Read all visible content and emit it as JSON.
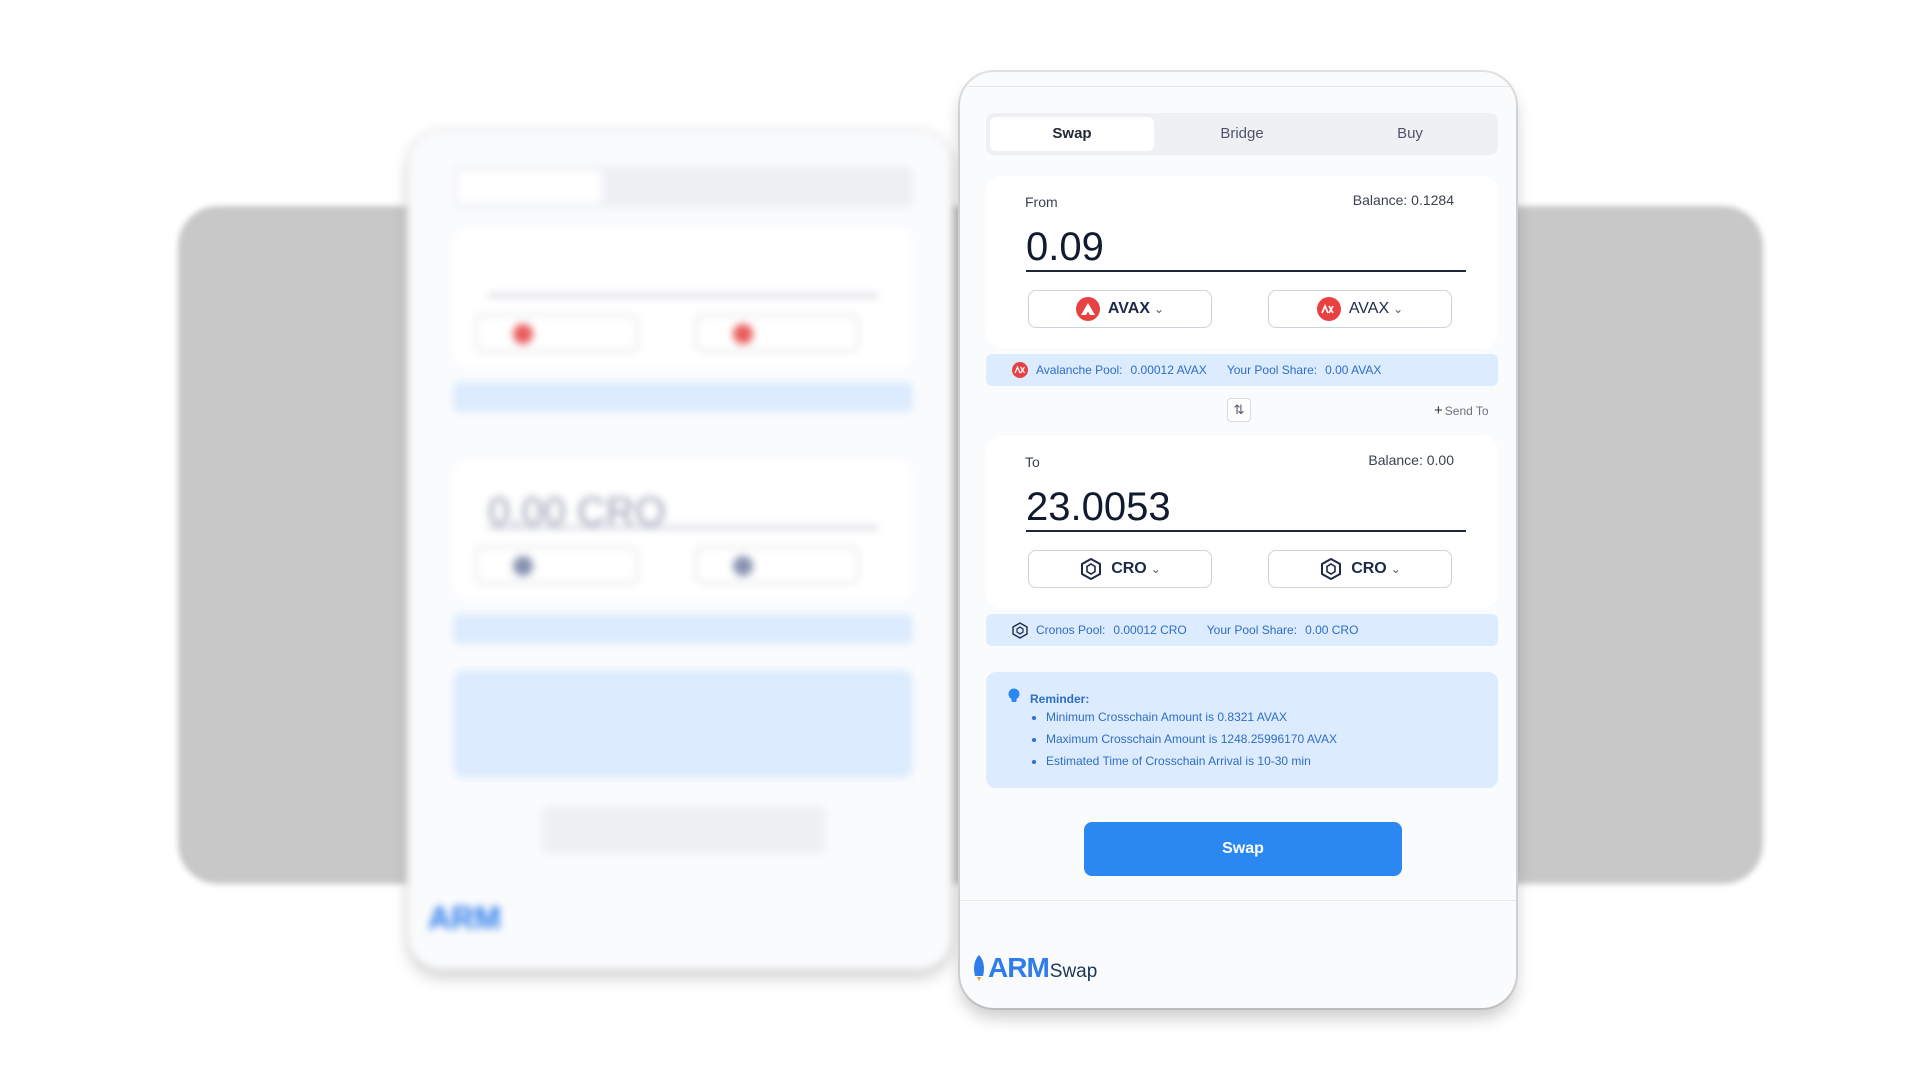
{
  "tabs": [
    {
      "label": "Swap",
      "active": true
    },
    {
      "label": "Bridge",
      "active": false
    },
    {
      "label": "Buy",
      "active": false
    }
  ],
  "from": {
    "label": "From",
    "balance": "Balance: 0.1284",
    "amount": "0.09",
    "source_token": "AVAX",
    "dest_token": "AVAX"
  },
  "avax_pool": {
    "label": "Avalanche Pool:",
    "value": "0.00012 AVAX",
    "share_label": "Your Pool Share:",
    "share_value": "0.00 AVAX"
  },
  "send_to": "Send To",
  "to": {
    "label": "To",
    "balance": "Balance: 0.00",
    "amount": "23.0053",
    "source_token": "CRO",
    "dest_token": "CRO"
  },
  "cro_pool": {
    "label": "Cronos Pool:",
    "value": "0.00012 CRO",
    "share_label": "Your Pool Share:",
    "share_value": "0.00 CRO"
  },
  "reminder": {
    "title": "Reminder:",
    "items": [
      "Minimum Crosschain Amount is 0.8321 AVAX",
      "Maximum Crosschain Amount is 1248.25996170 AVAX",
      "Estimated Time of Crosschain Arrival is 10-30 min"
    ]
  },
  "swap_button": "Swap",
  "logo": {
    "primary": "ARM",
    "secondary": "Swap"
  },
  "colors": {
    "accent": "#2b88f0",
    "info_bg": "#dcebfd",
    "avax_red": "#e84142",
    "cro_navy": "#1c2a4a"
  }
}
